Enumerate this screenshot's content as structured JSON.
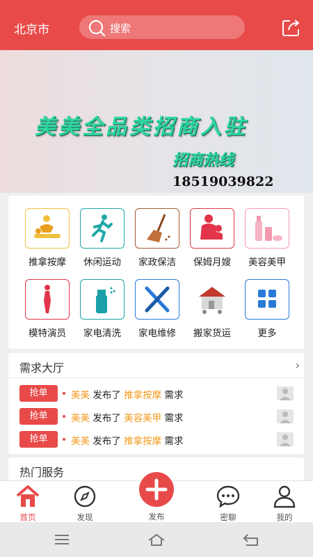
{
  "header": {
    "city": "北京市",
    "search_placeholder": "搜索",
    "bg_color": "#e84a4a"
  },
  "banner": {
    "title": "美美全品类招商入驻",
    "subtitle": "招商热线",
    "phone": "18519039822"
  },
  "categories": [
    {
      "label": "推拿按摩",
      "icon": "massage-icon",
      "color": "#f0c040"
    },
    {
      "label": "休闲运动",
      "icon": "runner-icon",
      "color": "#20a8a8"
    },
    {
      "label": "家政保洁",
      "icon": "broom-icon",
      "color": "#a05a30"
    },
    {
      "label": "保姆月嫂",
      "icon": "nanny-icon",
      "color": "#e2344a"
    },
    {
      "label": "美容美甲",
      "icon": "cosmetics-icon",
      "color": "#f39ab0"
    },
    {
      "label": "模特演员",
      "icon": "model-icon",
      "color": "#e2344a"
    },
    {
      "label": "家电清洗",
      "icon": "spray-icon",
      "color": "#1aa0a8"
    },
    {
      "label": "家电维修",
      "icon": "tools-icon",
      "color": "#2a7ad8"
    },
    {
      "label": "搬家货运",
      "icon": "moving-house-icon",
      "color": "#c0392b"
    },
    {
      "label": "更多",
      "icon": "grid-more-icon",
      "color": "#2a7ad8"
    }
  ],
  "demand_hall": {
    "title": "需求大厅",
    "arrow": "›",
    "items": [
      {
        "button": "抢单",
        "user": "美美",
        "verb": "发布了",
        "service": "推拿按摩",
        "suffix": "需求"
      },
      {
        "button": "抢单",
        "user": "美美",
        "verb": "发布了",
        "service": "美容美甲",
        "suffix": "需求"
      },
      {
        "button": "抢单",
        "user": "美美",
        "verb": "发布了",
        "service": "推拿按摩",
        "suffix": "需求"
      }
    ]
  },
  "hot_services": {
    "title": "热门服务"
  },
  "tabbar": {
    "tabs": [
      {
        "label": "首页",
        "icon": "home-icon",
        "active": true
      },
      {
        "label": "发现",
        "icon": "compass-icon",
        "active": false
      },
      {
        "label": "发布",
        "icon": "plus-icon",
        "active": false
      },
      {
        "label": "密聊",
        "icon": "chat-bubble-icon",
        "active": false
      },
      {
        "label": "我的",
        "icon": "user-icon",
        "active": false
      }
    ]
  }
}
